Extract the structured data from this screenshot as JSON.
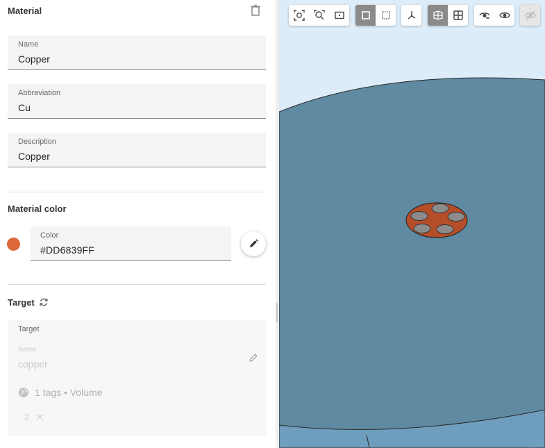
{
  "material": {
    "section_title": "Material",
    "name": {
      "label": "Name",
      "value": "Copper"
    },
    "abbreviation": {
      "label": "Abbreviation",
      "value": "Cu"
    },
    "description": {
      "label": "Description",
      "value": "Copper"
    }
  },
  "material_color": {
    "section_title": "Material color",
    "field_label": "Color",
    "value": "#DD6839FF",
    "swatch_color": "#DD6839"
  },
  "target": {
    "section_title": "Target",
    "card_label": "Target",
    "name_label": "Name",
    "name_value": "copper",
    "tags_text": "1 tags • Volume",
    "chip_value": "2",
    "chip_remove_glyph": "✕"
  },
  "viewer": {
    "toolbar_groups": [
      [
        "zoom-to-fit-icon",
        "zoom-to-selection-icon",
        "zoom-to-box-icon"
      ],
      [
        "solid-view-icon",
        "wireframe-view-icon"
      ],
      [
        "axes-icon"
      ],
      [
        "section-view-icon",
        "grid-view-icon"
      ],
      [
        "show-hidden-icon",
        "show-all-icon"
      ],
      [
        "hide-icon"
      ]
    ],
    "active_tools": [
      "solid-view-icon",
      "section-view-icon"
    ],
    "disabled_tools": [
      "hide-icon"
    ],
    "colors": {
      "background": "#dcecf8",
      "body": "#5f8aa1",
      "body_bottom": "#6f9dbd",
      "copper_part": "#b54e28",
      "holes": "#8c8c8c"
    }
  }
}
